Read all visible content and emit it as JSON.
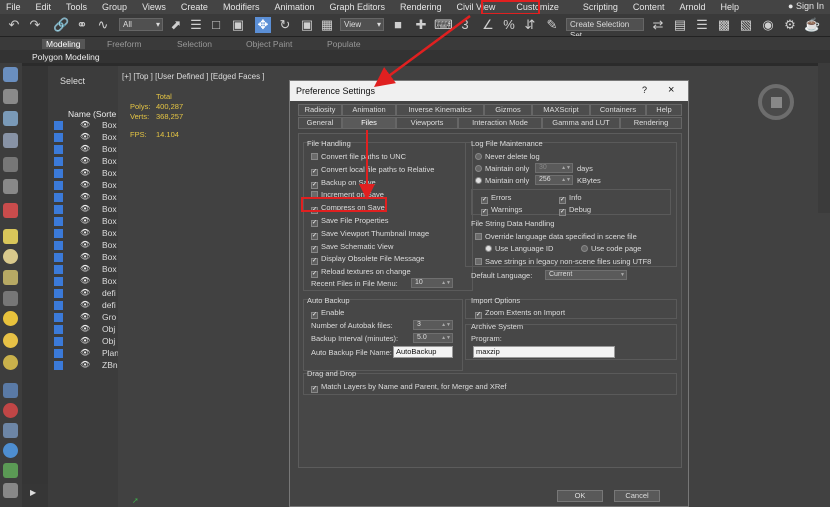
{
  "menu": [
    "File",
    "Edit",
    "Tools",
    "Group",
    "Views",
    "Create",
    "Modifiers",
    "Animation",
    "Graph Editors",
    "Rendering",
    "Civil View",
    "Customize",
    "Scripting",
    "Content",
    "Arnold",
    "Help"
  ],
  "signin": "Sign In",
  "toolbar": {
    "filter": "All",
    "view": "View",
    "selset": "Create Selection Set"
  },
  "ribbon": {
    "tabs": [
      "Modeling",
      "Freeform",
      "Selection",
      "Object Paint",
      "Populate"
    ],
    "sub": "Polygon Modeling"
  },
  "scene": {
    "select_label": "Select",
    "name_header": "Name (Sorte",
    "rows": [
      "Box",
      "Box",
      "Box",
      "Box",
      "Box",
      "Box",
      "Box",
      "Box",
      "Box",
      "Box",
      "Box",
      "Box",
      "Box",
      "Box",
      "defi",
      "defi",
      "Gro",
      "Obj",
      "Obj",
      "Plan",
      "ZBn"
    ]
  },
  "viewport": {
    "label": "[+] [Top ] [User Defined ] [Edged Faces ]",
    "total": "Total",
    "polys_label": "Polys:",
    "polys": "400,287",
    "verts_label": "Verts:",
    "verts": "368,257",
    "fps_label": "FPS:",
    "fps": "14.104"
  },
  "dialog": {
    "title": "Preference Settings",
    "help": "?",
    "close": "×",
    "tabs_row1": [
      "Radiosity",
      "Animation",
      "Inverse Kinematics",
      "Gizmos",
      "MAXScript",
      "Containers",
      "Help"
    ],
    "tabs_row2": [
      "General",
      "Files",
      "Viewports",
      "Interaction Mode",
      "Gamma and LUT",
      "Rendering"
    ],
    "file_handling": {
      "title": "File Handling",
      "items": [
        {
          "label": "Convert file paths to UNC",
          "checked": false
        },
        {
          "label": "Convert local file paths to Relative",
          "checked": true
        },
        {
          "label": "Backup on Save",
          "checked": true
        },
        {
          "label": "Increment on Save",
          "checked": false
        },
        {
          "label": "Compress on Save",
          "checked": true
        },
        {
          "label": "Save File Properties",
          "checked": true
        },
        {
          "label": "Save Viewport Thumbnail Image",
          "checked": true
        },
        {
          "label": "Save Schematic View",
          "checked": true
        },
        {
          "label": "Display Obsolete File Message",
          "checked": true
        },
        {
          "label": "Reload textures on change",
          "checked": true
        }
      ],
      "recent_label": "Recent Files in File Menu:",
      "recent_value": "10"
    },
    "log": {
      "title": "Log File Maintenance",
      "never": "Never delete log",
      "maintain1": "Maintain only",
      "days_value": "30",
      "days": "days",
      "maintain2": "Maintain only",
      "kb_value": "256",
      "kb": "KBytes",
      "errors": "Errors",
      "info": "Info",
      "warnings": "Warnings",
      "debug": "Debug"
    },
    "filestring": {
      "title": "File String Data Handling",
      "override": "Override language data specified in scene file",
      "use_lang": "Use Language ID",
      "use_code": "Use code page",
      "utf8": "Save strings in legacy non-scene files using UTF8",
      "default_label": "Default Language:",
      "default_value": "Current"
    },
    "autobackup": {
      "title": "Auto Backup",
      "enable": "Enable",
      "num_label": "Number of Autobak files:",
      "num_value": "3",
      "interval_label": "Backup Interval (minutes):",
      "interval_value": "5.0",
      "name_label": "Auto Backup File Name:",
      "name_value": "AutoBackup"
    },
    "import": {
      "title": "Import Options",
      "zoom": "Zoom Extents on Import"
    },
    "archive": {
      "title": "Archive System",
      "program_label": "Program:",
      "program_value": "maxzip"
    },
    "dragdrop": {
      "title": "Drag and Drop",
      "match": "Match Layers by Name and Parent, for Merge and XRef"
    },
    "ok": "OK",
    "cancel": "Cancel"
  },
  "colors": {
    "annotation_red": "#e02020",
    "accent_blue": "#3b7ad9"
  }
}
